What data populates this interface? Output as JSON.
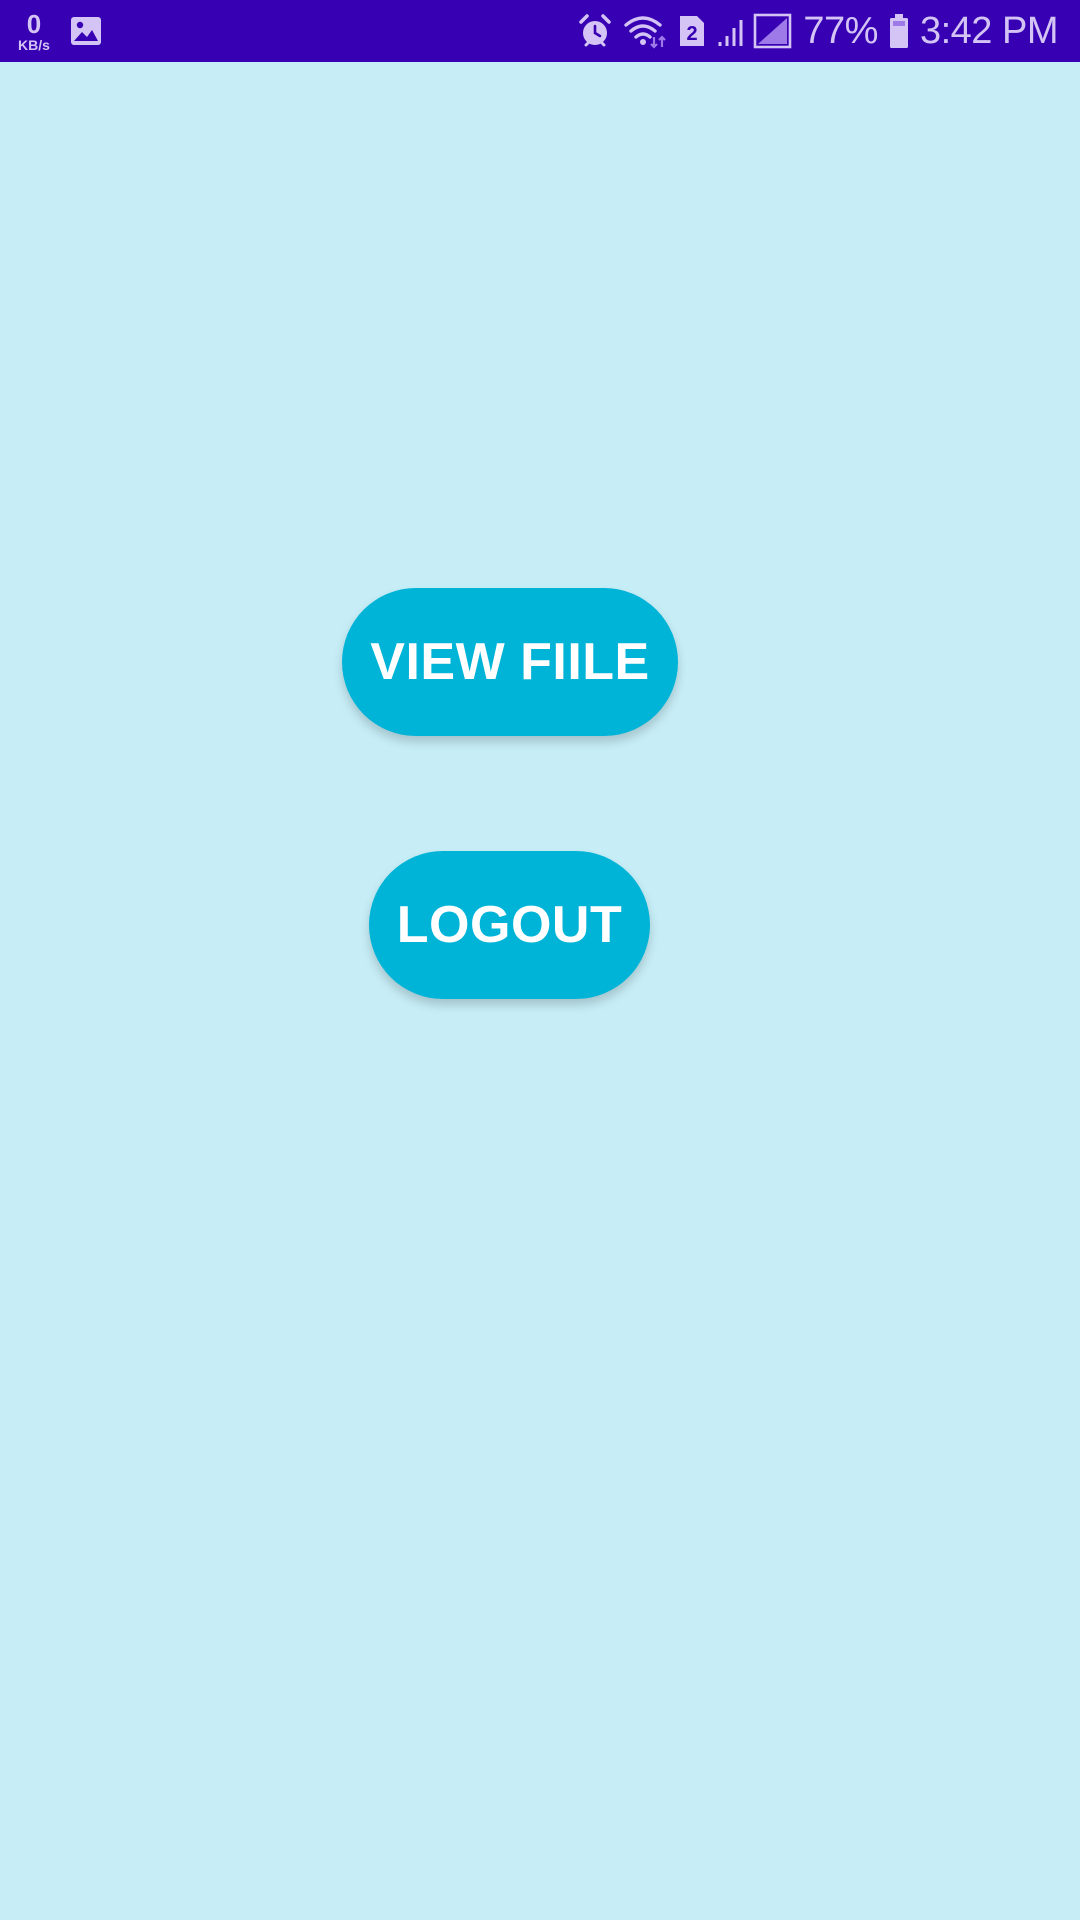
{
  "status_bar": {
    "net_speed_value": "0",
    "net_speed_unit": "KB/s",
    "sim_slot": "2",
    "battery_percent": "77%",
    "time": "3:42 PM",
    "icons": [
      "image-icon",
      "alarm-icon",
      "wifi-icon",
      "sim-2-icon",
      "signal-icon",
      "battery-icon"
    ],
    "background_color": "#3700b3",
    "icon_color": "#d4c4f5"
  },
  "main": {
    "background_color": "#c7eef7",
    "buttons": {
      "view_file_label": "VIEW FIILE",
      "logout_label": "LOGOUT",
      "color": "#00b4d8",
      "text_color": "#ffffff"
    }
  }
}
